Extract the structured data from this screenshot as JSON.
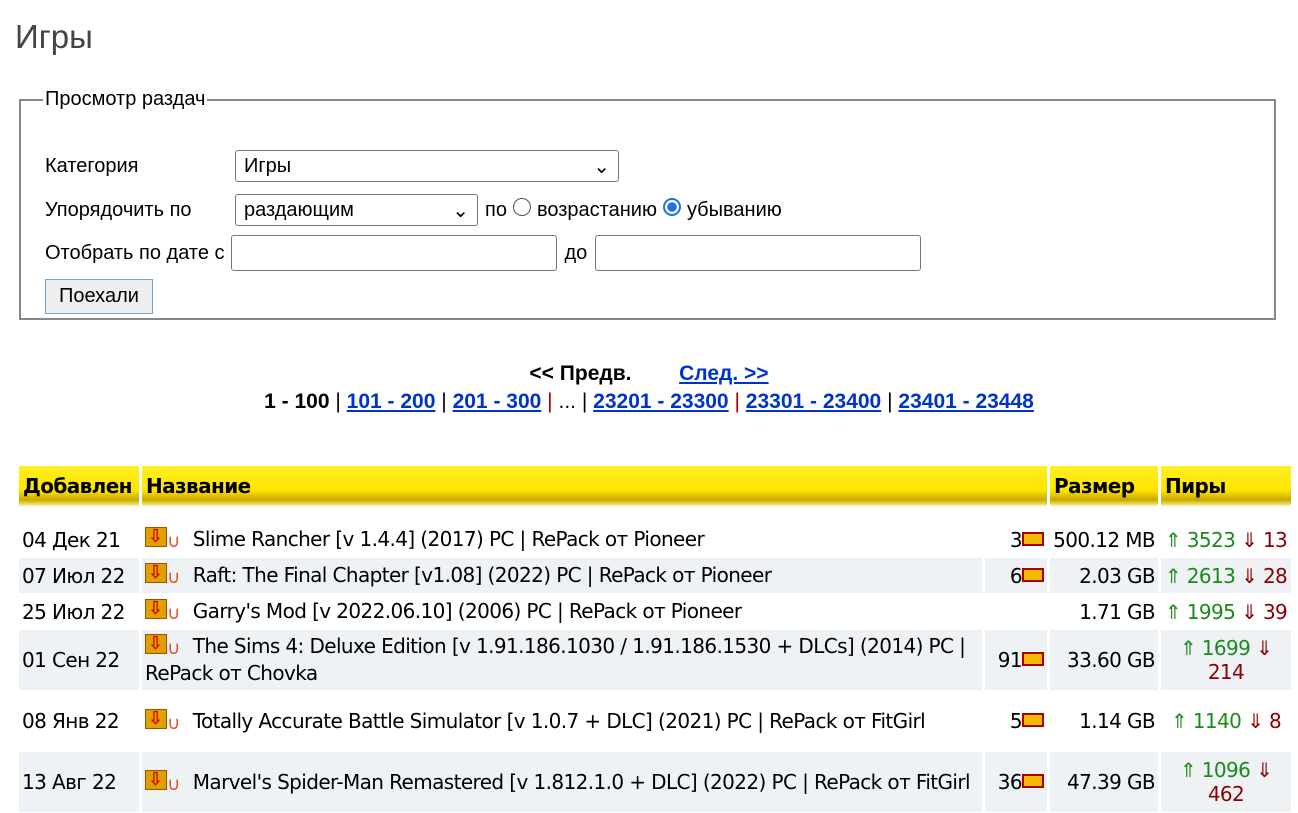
{
  "title": "Игры",
  "filter": {
    "legend": "Просмотр раздач",
    "category_label": "Категория",
    "category_value": "Игры",
    "order_label": "Упорядочить по",
    "order_value": "раздающим",
    "by": "по",
    "asc": "возрастанию",
    "desc": "убыванию",
    "date_label": "Отобрать по дате с",
    "date_to": "до",
    "date_from_value": "",
    "date_to_value": "",
    "submit": "Поехали"
  },
  "pager": {
    "prev": "<< Предв.",
    "next": "След. >>",
    "current": "1 - 100",
    "pages": [
      "101 - 200",
      "201 - 300",
      "23201 - 23300",
      "23301 - 23400",
      "23401 - 23448"
    ],
    "ellipsis": "..."
  },
  "table": {
    "headers": [
      "Добавлен",
      "Название",
      "Размер",
      "Пиры"
    ],
    "rows": [
      {
        "date": "04 Дек 21",
        "name": "Slime Rancher [v 1.4.4] (2017) PC | RePack от Pioneer",
        "comments": "3",
        "size": "500.12 MB",
        "seeds": "3523",
        "leech": "13"
      },
      {
        "date": "07 Июл 22",
        "name": "Raft: The Final Chapter [v1.08] (2022) PC | RePack от Pioneer",
        "comments": "6",
        "size": "2.03 GB",
        "seeds": "2613",
        "leech": "28"
      },
      {
        "date": "25 Июл 22",
        "name": "Garry's Mod [v 2022.06.10] (2006) PC | RePack от Pioneer",
        "comments": "",
        "size": "1.71 GB",
        "seeds": "1995",
        "leech": "39"
      },
      {
        "date": "01 Сен 22",
        "name": "The Sims 4: Deluxe Edition [v 1.91.186.1030 / 1.91.186.1530 + DLCs] (2014) PC | RePack от Chovka",
        "comments": "91",
        "size": "33.60 GB",
        "seeds": "1699",
        "leech": "214"
      },
      {
        "date": "08 Янв 22",
        "name": "Totally Accurate Battle Simulator [v 1.0.7 + DLC] (2021) PC | RePack от FitGirl",
        "comments": "5",
        "size": "1.14 GB",
        "seeds": "1140",
        "leech": "8"
      },
      {
        "date": "13 Авг 22",
        "name": "Marvel's Spider-Man Remastered [v 1.812.1.0 + DLC] (2022) PC | RePack от FitGirl",
        "comments": "36",
        "size": "47.39 GB",
        "seeds": "1096",
        "leech": "462"
      }
    ]
  }
}
